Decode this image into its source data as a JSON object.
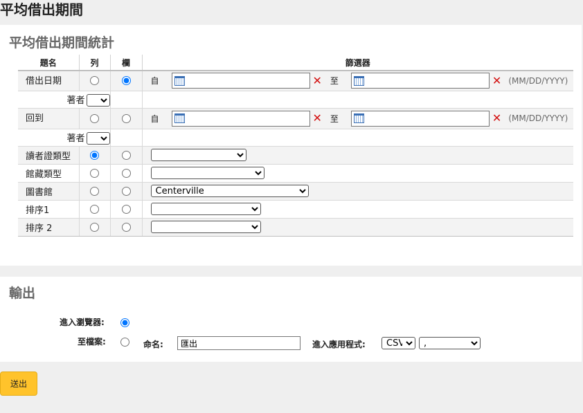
{
  "page": {
    "title": "平均借出期間"
  },
  "stats_panel": {
    "title": "平均借出期間統計",
    "columns": {
      "name": "題名",
      "row": "列",
      "col": "欄",
      "filter": "篩選器"
    },
    "from_label": "自",
    "to_label": "至",
    "date_format": "(MM/DD/YYYY)",
    "clear_symbol": "✕",
    "author_label": "著者",
    "rows": {
      "checkout_date": {
        "label": "借出日期",
        "row_selected": false,
        "col_selected": true
      },
      "return": {
        "label": "回到",
        "row_selected": false,
        "col_selected": false
      },
      "patron_category": {
        "label": "讀者證類型",
        "row_selected": true,
        "col_selected": false,
        "value": ""
      },
      "item_type": {
        "label": "館藏類型",
        "row_selected": false,
        "col_selected": false,
        "value": ""
      },
      "library": {
        "label": "圖書館",
        "row_selected": false,
        "col_selected": false,
        "value": "Centerville"
      },
      "sort1": {
        "label": "排序1",
        "row_selected": false,
        "col_selected": false,
        "value": ""
      },
      "sort2": {
        "label": "排序 2",
        "row_selected": false,
        "col_selected": false,
        "value": ""
      }
    }
  },
  "output_panel": {
    "title": "輸出",
    "to_browser_label": "進入瀏覽器:",
    "to_file_label": "至檔案:",
    "name_label": "命名:",
    "name_value": "匯出",
    "app_label": "進入應用程式:",
    "format_value": "CSV",
    "delimiter_value": ","
  },
  "submit_label": "送出"
}
